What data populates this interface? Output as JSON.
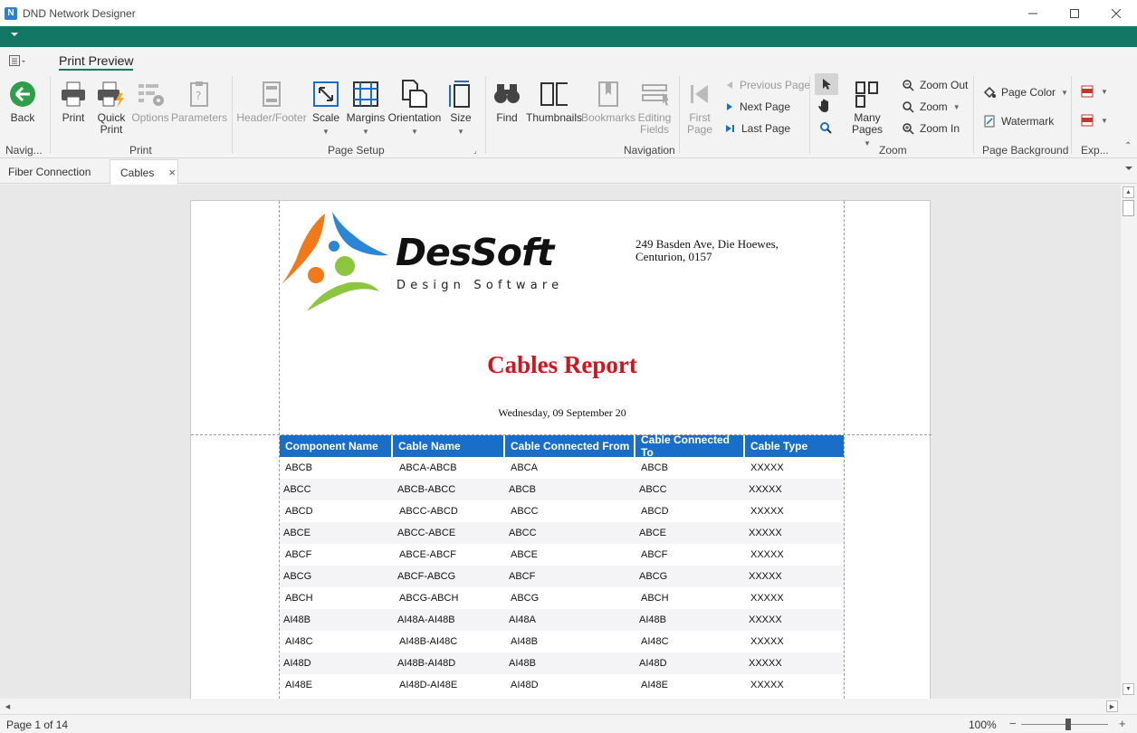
{
  "window": {
    "title": "DND Network Designer",
    "app_icon_letter": "N"
  },
  "ribbon": {
    "tab": "Print Preview",
    "groups": {
      "navigation": {
        "label": "Navig...",
        "back": "Back"
      },
      "print": {
        "label": "Print",
        "print": "Print",
        "quick_print_1": "Quick",
        "quick_print_2": "Print",
        "options": "Options",
        "parameters": "Parameters"
      },
      "page_setup": {
        "label": "Page Setup",
        "header_footer": "Header/Footer",
        "scale": "Scale",
        "margins": "Margins",
        "orientation": "Orientation",
        "size": "Size"
      },
      "navigation2": {
        "label": "Navigation",
        "find": "Find",
        "thumbnails": "Thumbnails",
        "bookmarks": "Bookmarks",
        "editing_fields_1": "Editing",
        "editing_fields_2": "Fields",
        "first_page_1": "First",
        "first_page_2": "Page",
        "previous_page": "Previous Page",
        "next_page": "Next Page",
        "last_page": "Last Page"
      },
      "zoom": {
        "label": "Zoom",
        "many_pages": "Many Pages",
        "zoom_out": "Zoom Out",
        "zoom": "Zoom",
        "zoom_in": "Zoom In"
      },
      "page_background": {
        "label": "Page Background",
        "page_color": "Page Color",
        "watermark": "Watermark"
      },
      "export": {
        "label": "Exp..."
      }
    }
  },
  "doc_tabs": [
    {
      "label": "Fiber Connection"
    },
    {
      "label": "Cables",
      "close": "×"
    }
  ],
  "report": {
    "company": "DesSoft",
    "tagline": "Design Software",
    "address_line1": "249 Basden Ave, Die Hoewes,",
    "address_line2": "Centurion, 0157",
    "title": "Cables Report",
    "date": "Wednesday, 09 September 20",
    "columns": [
      "Component Name",
      "Cable Name",
      "Cable Connected From",
      "Cable Connected To",
      "Cable Type"
    ],
    "rows": [
      [
        "ABCB",
        "ABCA-ABCB",
        "ABCA",
        "ABCB",
        "XXXXX"
      ],
      [
        "ABCC",
        "ABCB-ABCC",
        "ABCB",
        "ABCC",
        "XXXXX"
      ],
      [
        "ABCD",
        "ABCC-ABCD",
        "ABCC",
        "ABCD",
        "XXXXX"
      ],
      [
        "ABCE",
        "ABCC-ABCE",
        "ABCC",
        "ABCE",
        "XXXXX"
      ],
      [
        "ABCF",
        "ABCE-ABCF",
        "ABCE",
        "ABCF",
        "XXXXX"
      ],
      [
        "ABCG",
        "ABCF-ABCG",
        "ABCF",
        "ABCG",
        "XXXXX"
      ],
      [
        "ABCH",
        "ABCG-ABCH",
        "ABCG",
        "ABCH",
        "XXXXX"
      ],
      [
        "AI48B",
        "AI48A-AI48B",
        "AI48A",
        "AI48B",
        "XXXXX"
      ],
      [
        "AI48C",
        "AI48B-AI48C",
        "AI48B",
        "AI48C",
        "XXXXX"
      ],
      [
        "AI48D",
        "AI48B-AI48D",
        "AI48B",
        "AI48D",
        "XXXXX"
      ],
      [
        "AI48E",
        "AI48D-AI48E",
        "AI48D",
        "AI48E",
        "XXXXX"
      ]
    ]
  },
  "status": {
    "page": "Page 1 of 14",
    "zoom": "100%",
    "zoom_minus": "−",
    "zoom_plus": "+"
  },
  "colors": {
    "accent": "#137766",
    "table_header": "#1a6ec7",
    "title_red": "#d0151c"
  }
}
